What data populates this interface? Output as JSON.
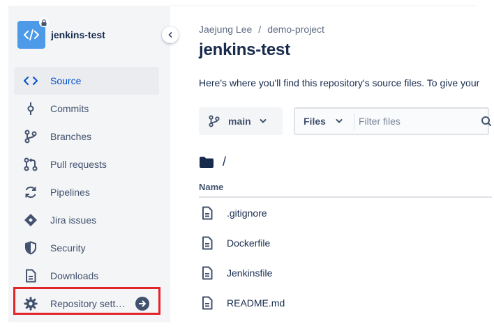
{
  "sidebar": {
    "repo_name": "jenkins-test",
    "items": [
      {
        "label": "Source",
        "icon": "code-icon",
        "active": true
      },
      {
        "label": "Commits",
        "icon": "commit-icon"
      },
      {
        "label": "Branches",
        "icon": "branch-icon"
      },
      {
        "label": "Pull requests",
        "icon": "pull-request-icon"
      },
      {
        "label": "Pipelines",
        "icon": "pipelines-icon"
      },
      {
        "label": "Jira issues",
        "icon": "jira-icon"
      },
      {
        "label": "Security",
        "icon": "shield-icon"
      },
      {
        "label": "Downloads",
        "icon": "document-icon"
      },
      {
        "label": "Repository sett…",
        "icon": "gear-icon"
      }
    ]
  },
  "header": {
    "breadcrumb": [
      "Jaejung Lee",
      "demo-project"
    ],
    "breadcrumb_separator": "/",
    "title": "jenkins-test",
    "description": "Here's where you'll find this repository's source files. To give your"
  },
  "toolbar": {
    "branch": "main",
    "files_select": "Files",
    "filter_placeholder": "Filter files"
  },
  "browser": {
    "path": "/",
    "column_name": "Name",
    "files": [
      ".gitignore",
      "Dockerfile",
      "Jenkinsfile",
      "README.md"
    ]
  },
  "colors": {
    "accent": "#0052cc",
    "avatar": "#4c9ae8",
    "highlight": "#e3242b"
  }
}
